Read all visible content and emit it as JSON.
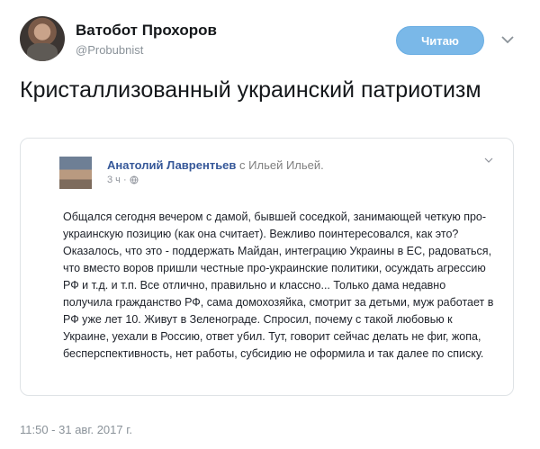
{
  "author": {
    "name": "Ватобот Прохоров",
    "handle": "@Probubnist",
    "follow_label": "Читаю"
  },
  "tweet": {
    "text": "Кристаллизованный украинский патриотизм",
    "timestamp": "11:50 - 31 авг. 2017 г."
  },
  "quoted_post": {
    "author": "Анатолий Лаврентьев",
    "with_text": "с Ильей Ильей.",
    "meta": "3 ч ·",
    "body": "Общался сегодня вечером с дамой, бывшей соседкой, занимающей четкую про-украинскую позицию (как она считает). Вежливо поинтересовался, как это? Оказалось, что это - поддержать Майдан, интеграцию Украины в ЕС, радоваться, что вместо воров пришли честные про-украинские политики, осуждать агрессию РФ и т.д. и т.п. Все отлично, правильно и классно... Только дама недавно получила гражданство РФ, сама домохозяйка, смотрит за детьми, муж работает в РФ уже лет 10. Живут в Зеленограде. Спросил, почему с такой любовью к Украине, уехали в Россию, ответ убил. Тут, говорит сейчас делать не фиг, жопа, бесперспективность, нет работы, субсидию не оформила и так далее по списку."
  },
  "icons": {
    "chevron": "chevron-down-icon",
    "globe": "globe-icon",
    "more": "more-icon"
  },
  "colors": {
    "follow_button": "#7ab8e8",
    "link_name": "#365899"
  }
}
